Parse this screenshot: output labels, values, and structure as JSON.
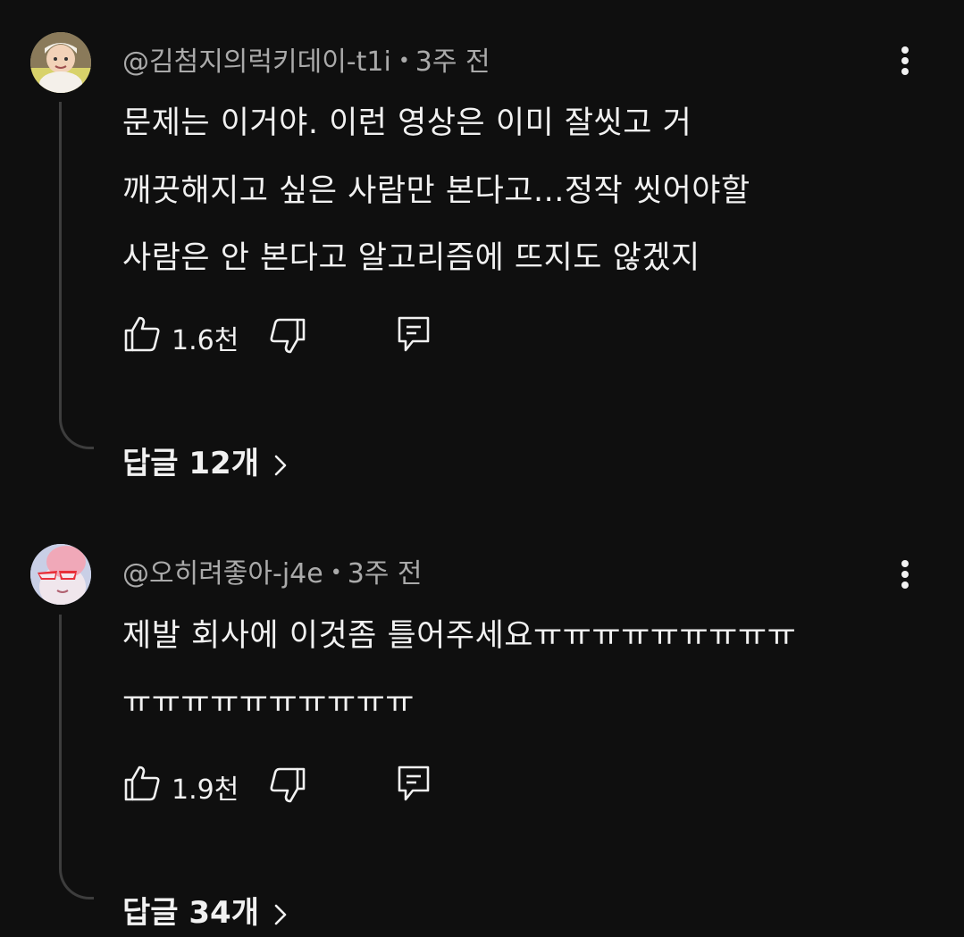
{
  "comments": [
    {
      "author": "@김첨지의럭키데이-t1i",
      "time": "3주 전",
      "lines": [
        "문제는 이거야. 이런 영상은 이미 잘씻고 거",
        "깨끗해지고 싶은 사람만 본다고...정작 씻어야할",
        "사람은 안 본다고 알고리즘에 뜨지도 않겠지"
      ],
      "likes": "1.6천",
      "replies": "답글 12개"
    },
    {
      "author": "@오히려좋아-j4e",
      "time": "3주 전",
      "lines": [
        "제발 회사에 이것좀 틀어주세요ㅠㅠㅠㅠㅠㅠㅠㅠㅠ",
        "ㅠㅠㅠㅠㅠㅠㅠㅠㅠㅠ"
      ],
      "likes": "1.9천",
      "replies": "답글 34개"
    }
  ],
  "icons": {
    "like": "thumb-up-icon",
    "dislike": "thumb-down-icon",
    "reply": "reply-comment-icon",
    "more": "more-vertical-icon",
    "chevron": "chevron-right-icon"
  },
  "colors": {
    "background": "#0f0f0f",
    "text": "#f1f1f1",
    "secondary_text": "#aaaaaa",
    "thread_line": "#3d3d3d"
  }
}
